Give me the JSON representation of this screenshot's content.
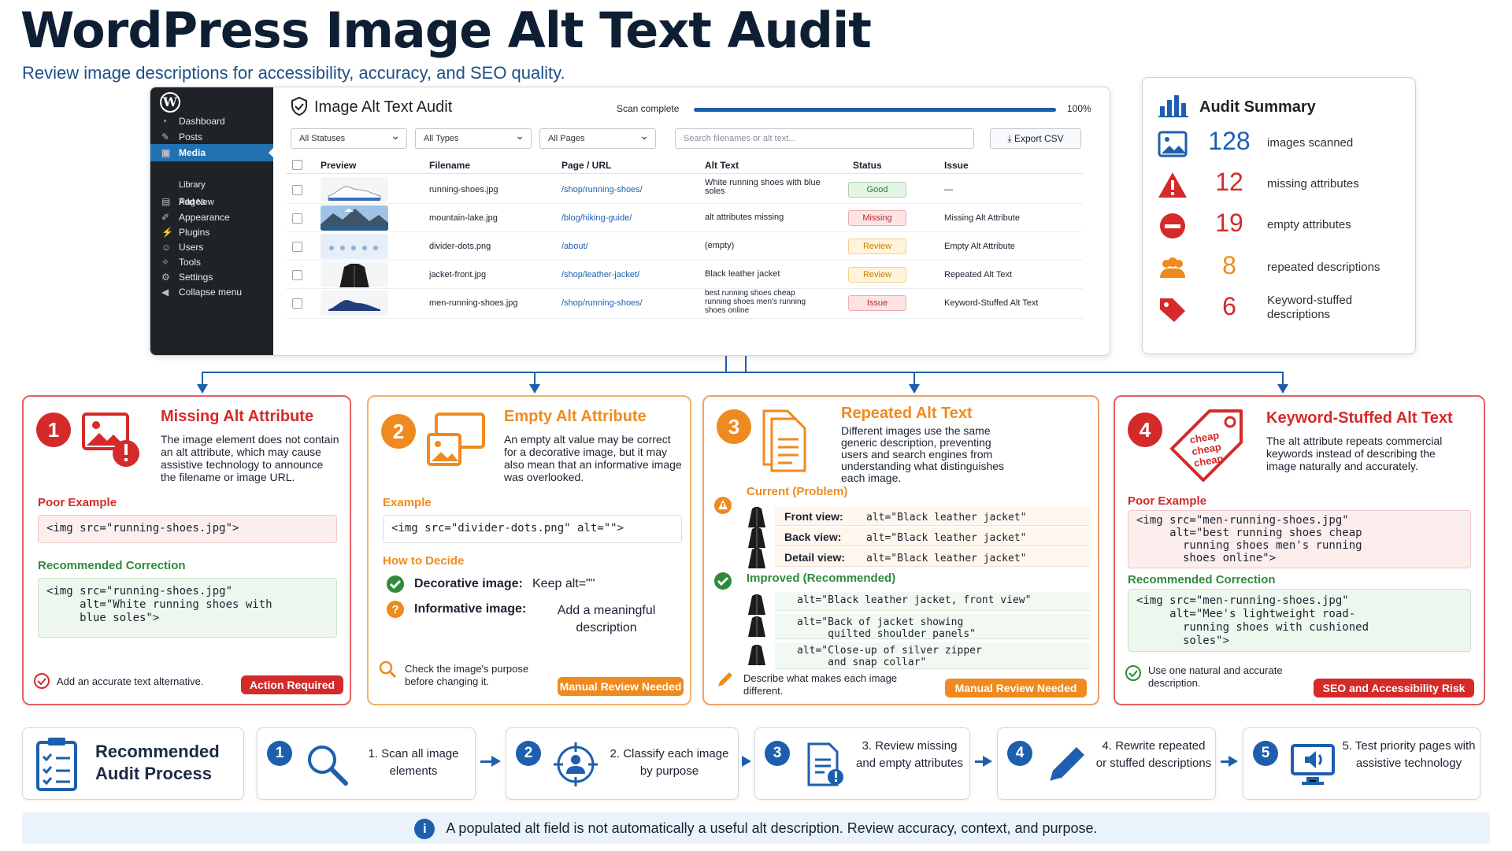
{
  "page": {
    "title": "WordPress Image Alt Text Audit",
    "subtitle": "Review image descriptions for accessibility, accuracy, and SEO quality."
  },
  "wp": {
    "nav": [
      {
        "label": "Dashboard",
        "icon": "dashboard-icon"
      },
      {
        "label": "Posts",
        "icon": "pin-icon"
      },
      {
        "label": "Media",
        "icon": "media-icon",
        "active": true
      },
      {
        "label": "Pages",
        "icon": "pages-icon"
      },
      {
        "label": "Appearance",
        "icon": "brush-icon"
      },
      {
        "label": "Plugins",
        "icon": "plug-icon"
      },
      {
        "label": "Users",
        "icon": "user-icon"
      },
      {
        "label": "Tools",
        "icon": "wrench-icon"
      },
      {
        "label": "Settings",
        "icon": "gear-icon"
      },
      {
        "label": "Collapse menu",
        "icon": "collapse-icon"
      }
    ],
    "sub": [
      "Library",
      "Add New"
    ]
  },
  "audit": {
    "title": "Image Alt Text Audit",
    "scan_label": "Scan complete",
    "progress": 1.0,
    "progress_text": "100%",
    "filters": [
      "All Statuses",
      "All Types",
      "All Pages"
    ],
    "search_placeholder": "Search filenames or alt text...",
    "export": "Export CSV",
    "columns": [
      "Preview",
      "Filename",
      "Page / URL",
      "Alt Text",
      "Status",
      "Issue"
    ],
    "rows": [
      {
        "file": "running-shoes.jpg",
        "url": "/shop/running-shoes/",
        "alt": "White running shoes with blue soles",
        "status": "Good",
        "issue": "—",
        "kind": "good"
      },
      {
        "file": "mountain-lake.jpg",
        "url": "/blog/hiking-guide/",
        "alt": "alt attributes missing",
        "status": "Missing",
        "issue": "Missing Alt Attribute",
        "kind": "miss"
      },
      {
        "file": "divider-dots.png",
        "url": "/about/",
        "alt": "(empty)",
        "status": "Review",
        "issue": "Empty Alt Attribute",
        "kind": "rev"
      },
      {
        "file": "jacket-front.jpg",
        "url": "/shop/leather-jacket/",
        "alt": "Black leather jacket",
        "status": "Review",
        "issue": "Repeated Alt Text",
        "kind": "rev"
      },
      {
        "file": "men-running-shoes.jpg",
        "url": "/shop/running-shoes/",
        "alt": "best running shoes cheap running shoes men's running shoes online",
        "status": "Issue",
        "issue": "Keyword-Stuffed Alt Text",
        "kind": "iss"
      }
    ]
  },
  "summary": {
    "title": "Audit Summary",
    "items": [
      {
        "value": "128",
        "label": "images scanned",
        "color": "#1d5fae"
      },
      {
        "value": "12",
        "label": "missing attributes",
        "color": "#d42a2a"
      },
      {
        "value": "19",
        "label": "empty attributes",
        "color": "#d42a2a"
      },
      {
        "value": "8",
        "label": "repeated descriptions",
        "color": "#ef8a1e"
      },
      {
        "value": "6",
        "label": "Keyword-stuffed descriptions",
        "color": "#d42a2a"
      }
    ]
  },
  "cards": [
    {
      "num": "1",
      "title": "Missing Alt Attribute",
      "desc": "The image element does not contain an alt attribute, which may cause assistive technology to announce the filename or image URL.",
      "poor_label": "Poor Example",
      "poor_code": "<img src=\"running-shoes.jpg\">",
      "rec_label": "Recommended Correction",
      "rec_code": "<img src=\"running-shoes.jpg\"\n     alt=\"White running shoes with\n     blue soles\">",
      "note": "Add an accurate text alternative.",
      "pill": "Action Required"
    },
    {
      "num": "2",
      "title": "Empty Alt Attribute",
      "desc": "An empty alt value may be correct for a decorative image, but it may also mean that an informative image was overlooked.",
      "ex_label": "Example",
      "ex_code": "<img src=\"divider-dots.png\" alt=\"\">",
      "decide_label": "How to Decide",
      "decor_label": "Decorative image:",
      "decor_value": "Keep alt=\"\"",
      "info_label": "Informative image:",
      "info_value": "Add a meaningful description",
      "note": "Check the image's purpose before changing it.",
      "pill": "Manual Review Needed"
    },
    {
      "num": "3",
      "title": "Repeated Alt Text",
      "desc": "Different images use the same generic description, preventing users and search engines from understanding what distinguishes each image.",
      "cur_label": "Current (Problem)",
      "current": [
        {
          "view": "Front view:",
          "alt": "alt=\"Black leather jacket\""
        },
        {
          "view": "Back view:",
          "alt": "alt=\"Black leather jacket\""
        },
        {
          "view": "Detail view:",
          "alt": "alt=\"Black leather jacket\""
        }
      ],
      "imp_label": "Improved (Recommended)",
      "improved": [
        "alt=\"Black leather jacket, front view\"",
        "alt=\"Back of jacket showing\n     quilted shoulder panels\"",
        "alt=\"Close-up of silver zipper\n     and snap collar\""
      ],
      "note": "Describe what makes each image different.",
      "pill": "Manual Review Needed"
    },
    {
      "num": "4",
      "title": "Keyword-Stuffed Alt Text",
      "desc": "The alt attribute repeats commercial keywords instead of describing the image naturally and accurately.",
      "tag_text": "cheap\ncheap\ncheap",
      "poor_label": "Poor Example",
      "poor_code": "<img src=\"men-running-shoes.jpg\"\n     alt=\"best running shoes cheap\n       running shoes men's running\n       shoes online\">",
      "rec_label": "Recommended Correction",
      "rec_code": "<img src=\"men-running-shoes.jpg\"\n     alt=\"Mee's lightweight road-\n       running shoes with cushioned\n       soles\">",
      "note": "Use one natural and accurate description.",
      "pill": "SEO and Accessibility Risk"
    }
  ],
  "process": {
    "title": "Recommended Audit Process",
    "steps": [
      {
        "num": "1",
        "text": "1. Scan all image elements"
      },
      {
        "num": "2",
        "text": "2. Classify each image by purpose"
      },
      {
        "num": "3",
        "text": "3. Review missing and empty attributes"
      },
      {
        "num": "4",
        "text": "4. Rewrite repeated or stuffed descriptions"
      },
      {
        "num": "5",
        "text": "5. Test priority pages with assistive technology"
      }
    ]
  },
  "footer": "A populated alt field is not automatically a useful alt description. Review accuracy, context, and purpose.",
  "colors": {
    "blue": "#1d5fae",
    "red": "#d42a2a",
    "orange": "#ef8a1e",
    "green": "#2f8a3a"
  }
}
